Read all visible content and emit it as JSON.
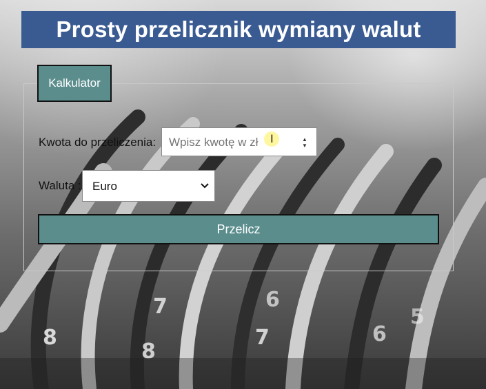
{
  "header": {
    "title": "Prosty przelicznik wymiany walut"
  },
  "calculator": {
    "legend": "Kalkulator",
    "amount_label": "Kwota do przeliczenia:",
    "amount_placeholder": "Wpisz kwotę w zł",
    "amount_value": "",
    "currency_label": "Waluta :",
    "currency_selected": "Euro",
    "submit_label": "Przelicz"
  },
  "icons": {
    "spinner": "number-spinner-icon",
    "select_arrow": "chevron-down-icon",
    "cursor": "text-cursor-icon"
  },
  "colors": {
    "header_bg": "#3a5b92",
    "accent": "#5b8d8d",
    "header_text": "#ffffff"
  }
}
